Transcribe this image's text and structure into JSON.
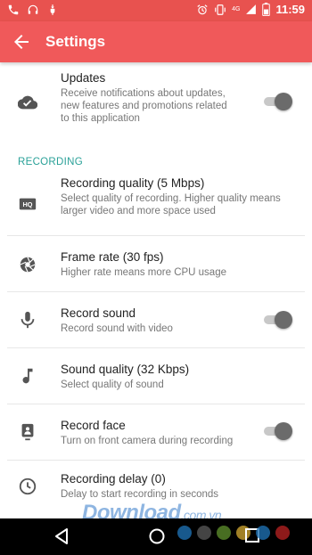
{
  "status_bar": {
    "time": "11:59",
    "badge_4g": "4G",
    "left_icons": [
      "phone-icon",
      "headset-icon",
      "usb-icon"
    ],
    "right_icons": [
      "alarm-icon",
      "vibrate-icon",
      "signal-icon",
      "battery-icon"
    ]
  },
  "app_bar": {
    "title": "Settings",
    "back_icon": "arrow-back-icon",
    "color": "#f0595a"
  },
  "settings": {
    "updates": {
      "title": "Updates",
      "subtitle_lines": [
        "Receive notifications about updates,",
        "new features and promotions related",
        "to this application"
      ],
      "icon": "cloud-check-icon",
      "toggle": "on"
    },
    "section_recording": "RECORDING",
    "recording_quality": {
      "title": "Recording quality (5 Mbps)",
      "subtitle_lines": [
        "Select quality of recording. Higher quality means",
        "larger video and more space used"
      ],
      "icon": "hq-icon"
    },
    "frame_rate": {
      "title": "Frame rate (30 fps)",
      "subtitle": "Higher rate means more CPU usage",
      "icon": "aperture-icon"
    },
    "record_sound": {
      "title": "Record sound",
      "subtitle": "Record sound with video",
      "icon": "mic-icon",
      "toggle": "on"
    },
    "sound_quality": {
      "title": "Sound quality (32 Kbps)",
      "subtitle": "Select quality of sound",
      "icon": "music-note-icon"
    },
    "record_face": {
      "title": "Record face",
      "subtitle": "Turn on front camera during recording",
      "icon": "front-camera-icon",
      "toggle": "on"
    },
    "recording_delay": {
      "title": "Recording delay (0)",
      "subtitle": "Delay to start recording in seconds",
      "icon": "clock-icon"
    }
  },
  "nav_bar": {
    "icons": [
      "back-triangle-icon",
      "home-circle-icon",
      "recents-square-icon"
    ]
  },
  "watermark": {
    "text": "Download",
    "suffix": ".com.vn",
    "dot_colors": [
      "#1e6fb0",
      "#555555",
      "#5a8a2a",
      "#c8a030",
      "#1e6fb0",
      "#b02020"
    ]
  }
}
